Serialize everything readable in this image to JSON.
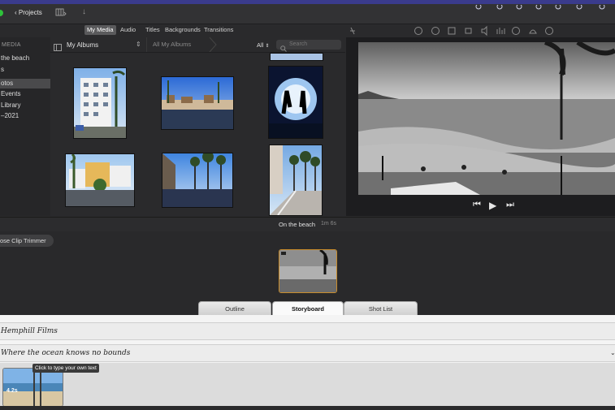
{
  "toolbar": {
    "projects_label": "Projects",
    "back_chevron": "‹",
    "download_icon": "↓"
  },
  "media_tabs": [
    {
      "label": "My Media",
      "selected": true
    },
    {
      "label": "Audio",
      "selected": false
    },
    {
      "label": "Titles",
      "selected": false
    },
    {
      "label": "Backgrounds",
      "selected": false
    },
    {
      "label": "Transitions",
      "selected": false
    }
  ],
  "sidebar": {
    "header": "MEDIA",
    "items": [
      {
        "label": "the beach",
        "selected": false
      },
      {
        "label": "s",
        "selected": false
      },
      {
        "label": "otos",
        "selected": true
      },
      {
        "label": "Events",
        "selected": false
      },
      {
        "label": "Library",
        "selected": false
      },
      {
        "label": "–2021",
        "selected": false
      }
    ]
  },
  "browser": {
    "album_select": "My Albums",
    "album_tab": "All My Albums",
    "filter": "All",
    "search_placeholder": "Search"
  },
  "viewer_controls": {
    "prev": "⏮",
    "play": "▶",
    "next": "⏭"
  },
  "timeline": {
    "title": "On the beach",
    "duration": "1m 6s",
    "trimmer_label": "ose Clip Trimmer"
  },
  "trailer_tabs": [
    {
      "label": "Outline",
      "selected": false
    },
    {
      "label": "Storyboard",
      "selected": true
    },
    {
      "label": "Shot List",
      "selected": false
    }
  ],
  "trailer": {
    "field1": "Hemphill Films",
    "field2": "Where the ocean knows no bounds",
    "tooltip": "Click to type your own text",
    "shot_duration": "4.2s"
  },
  "colors": {
    "accent_selected": "#5a5a5c",
    "clip_border": "#c98d2c",
    "menubar": "#3a3b8c"
  }
}
